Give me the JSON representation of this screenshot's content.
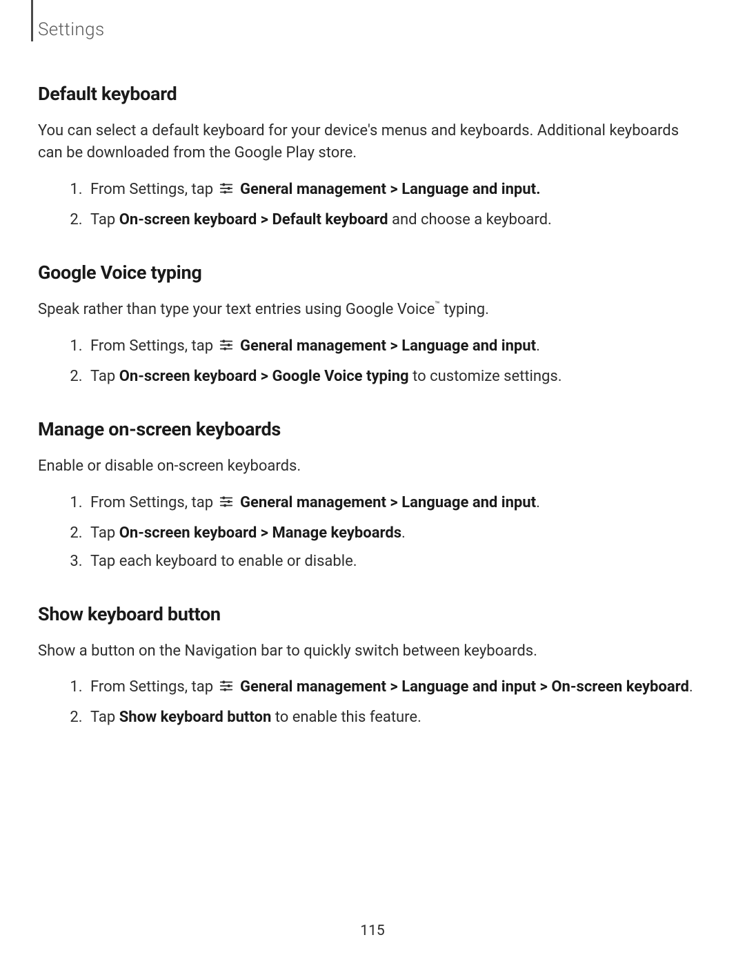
{
  "header": {
    "label": "Settings"
  },
  "sections": {
    "defaultKeyboard": {
      "title": "Default keyboard",
      "intro": "You can select a default keyboard for your device's menus and keyboards. Additional keyboards can be downloaded from the Google Play store.",
      "steps": {
        "s1_pre": "From Settings, tap ",
        "s1_bold": "General management > Language and input.",
        "s2_pre": "Tap ",
        "s2_bold": "On-screen keyboard > Default keyboard",
        "s2_post": " and choose a keyboard."
      }
    },
    "googleVoice": {
      "title": "Google Voice typing",
      "intro_pre": "Speak rather than type your text entries using Google Voice",
      "intro_tm": "™",
      "intro_post": " typing.",
      "steps": {
        "s1_pre": "From Settings, tap ",
        "s1_bold": "General management > Language and input",
        "s1_post": ".",
        "s2_pre": "Tap ",
        "s2_bold": "On-screen keyboard > Google Voice typing",
        "s2_post": " to customize settings."
      }
    },
    "manageKb": {
      "title": "Manage on-screen keyboards",
      "intro": "Enable or disable on-screen keyboards.",
      "steps": {
        "s1_pre": "From Settings, tap ",
        "s1_bold": "General management > Language and input",
        "s1_post": ".",
        "s2_pre": "Tap ",
        "s2_bold": "On-screen keyboard > Manage keyboards",
        "s2_post": ".",
        "s3": "Tap each keyboard to enable or disable."
      }
    },
    "showKbButton": {
      "title": "Show keyboard button",
      "intro": "Show a button on the Navigation bar to quickly switch between keyboards.",
      "steps": {
        "s1_pre": "From Settings, tap ",
        "s1_bold1": "General management > Language and input > On‑screen keyboard",
        "s1_post": ".",
        "s2_pre": "Tap ",
        "s2_bold": "Show keyboard button",
        "s2_post": " to enable this feature."
      }
    }
  },
  "icons": {
    "generalManagement": "sliders-icon"
  },
  "pageNumber": "115"
}
